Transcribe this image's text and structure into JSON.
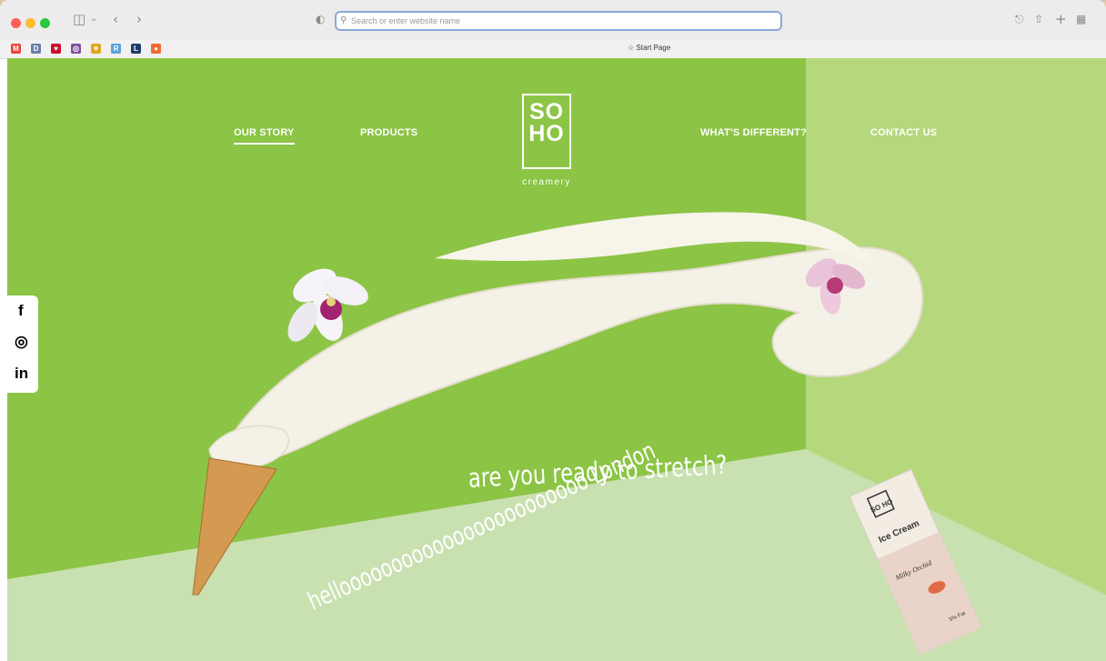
{
  "browser": {
    "address_placeholder": "Search or enter website name",
    "favorites_label": "Start Page",
    "favorites": [
      {
        "name": "gmail",
        "letter": "M",
        "color": "#ea4335"
      },
      {
        "name": "app2",
        "letter": "D",
        "color": "#6a7ea7"
      },
      {
        "name": "app3",
        "letter": "♥",
        "color": "#c8102e"
      },
      {
        "name": "app4",
        "letter": "◎",
        "color": "#7d4f9e"
      },
      {
        "name": "app5",
        "letter": "✶",
        "color": "#e5a51f"
      },
      {
        "name": "app6",
        "letter": "R",
        "color": "#5aa0d8"
      },
      {
        "name": "app7",
        "letter": "L",
        "color": "#1e3d6e"
      },
      {
        "name": "app8",
        "letter": "●",
        "color": "#f26a2e"
      }
    ]
  },
  "site": {
    "nav": {
      "our_story": "OUR STORY",
      "products": "PRODUCTS",
      "whats_different": "WHAT'S DIFFERENT?",
      "contact": "CONTACT US"
    },
    "logo": {
      "line1": "SO",
      "line2": "HO",
      "sub": "creamery"
    },
    "social": {
      "facebook": "f",
      "instagram": "◎",
      "linkedin": "in"
    },
    "headline": {
      "line1": "helloooooooooooooooooooooooo London",
      "line2": "are you ready to stretch?"
    },
    "product": {
      "logo": "SO HO",
      "desc": "Ice Cream",
      "flavour": "Milky Orchid",
      "fat": "5% Fat"
    },
    "colors": {
      "bright_green": "#8cc445",
      "light_green": "#b5d87c",
      "floor": "#c9e0b1",
      "cream": "#f4f1e6"
    }
  }
}
